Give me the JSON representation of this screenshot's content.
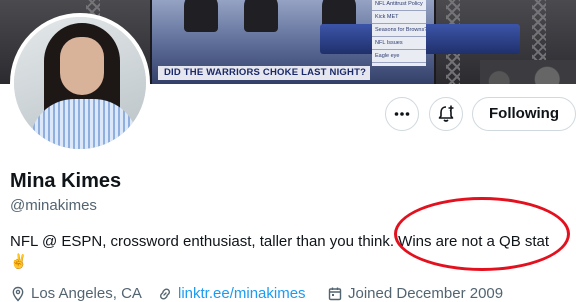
{
  "banner": {
    "chyron": "DID THE WARRIORS CHOKE LAST NIGHT?",
    "sidebar_items": [
      "NFL Antitrust Policy",
      "Kick MET",
      "Seasons for Browns?",
      "NFL Issues",
      "Eagle eye"
    ]
  },
  "profile": {
    "name": "Mina Kimes",
    "handle": "@minakimes",
    "bio": "NFL @ ESPN, crossword enthusiast, taller than you think. Wins are not a QB stat",
    "bio_emoji": "✌️",
    "location": "Los Angeles, CA",
    "link": "linktr.ee/minakimes",
    "joined": "Joined December 2009"
  },
  "actions": {
    "more_icon": "more-icon",
    "notify_icon": "notification-bell-icon",
    "follow_label": "Following"
  },
  "colors": {
    "link": "#1d9bf0",
    "secondary_text": "#536471",
    "highlight": "#e3101e"
  }
}
